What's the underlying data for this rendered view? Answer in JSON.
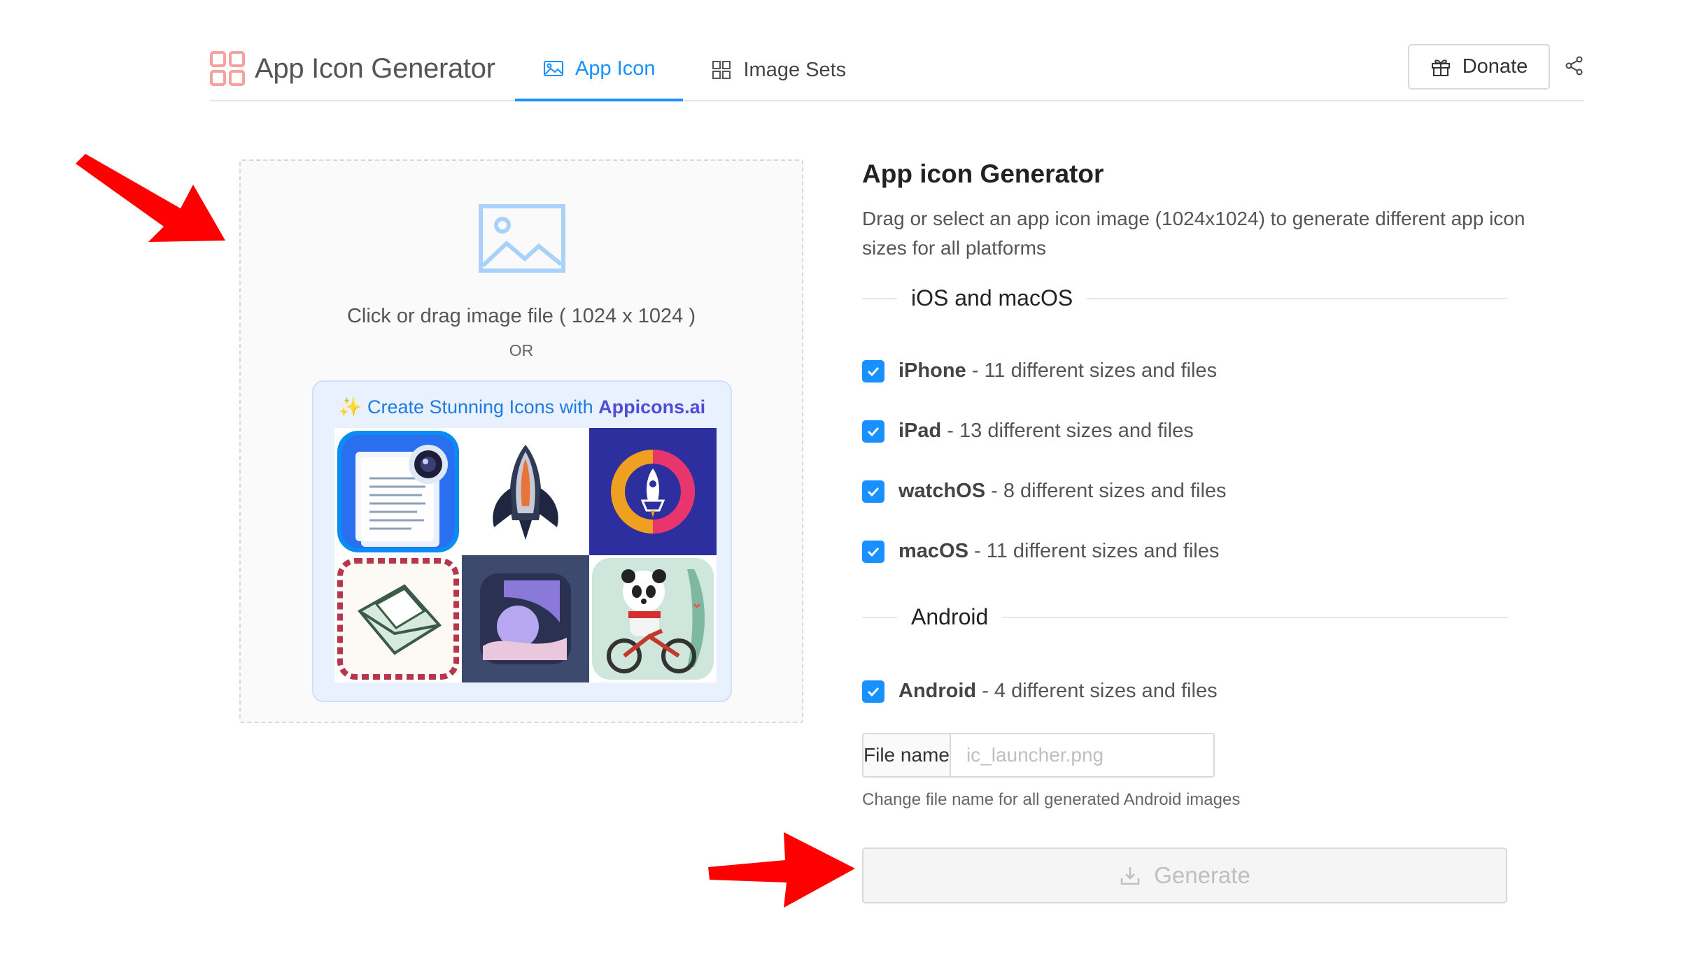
{
  "header": {
    "brand_title": "App Icon Generator",
    "tabs": [
      {
        "label": "App Icon",
        "icon": "image-icon",
        "active": true
      },
      {
        "label": "Image Sets",
        "icon": "grid-icon",
        "active": false
      }
    ],
    "donate_label": "Donate"
  },
  "upload": {
    "hint": "Click or drag image file ( 1024 x 1024 )",
    "or": "OR",
    "promo_prefix": "✨ Create Stunning Icons with ",
    "promo_brand": "Appicons.ai"
  },
  "panel": {
    "title": "App icon Generator",
    "description": "Drag or select an app icon image (1024x1024) to generate different app icon sizes for all platforms",
    "sections": {
      "ios": "iOS and macOS",
      "android": "Android"
    },
    "options": [
      {
        "name": "iPhone",
        "detail": " - 11 different sizes and files",
        "checked": true
      },
      {
        "name": "iPad",
        "detail": " - 13 different sizes and files",
        "checked": true
      },
      {
        "name": "watchOS",
        "detail": " - 8 different sizes and files",
        "checked": true
      },
      {
        "name": "macOS",
        "detail": " - 11 different sizes and files",
        "checked": true
      },
      {
        "name": "Android",
        "detail": " - 4 different sizes and files",
        "checked": true
      }
    ],
    "file_name_label": "File name",
    "file_name_placeholder": "ic_launcher.png",
    "file_name_help": "Change file name for all generated Android images",
    "generate_label": "Generate"
  },
  "colors": {
    "accent": "#1890ff",
    "arrow": "#ff0000",
    "promo_bg": "#e9f1fe",
    "promo_brand": "#4c4dd8"
  }
}
